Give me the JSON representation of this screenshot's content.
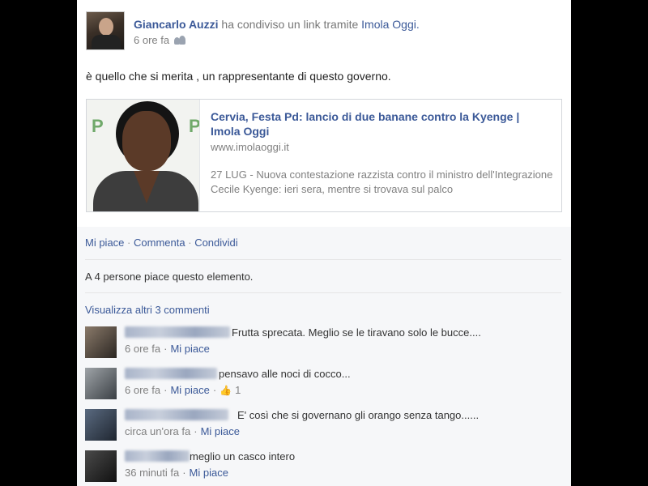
{
  "post": {
    "author": "Giancarlo Auzzi",
    "action_text": "ha condiviso un link tramite",
    "via": "Imola Oggi.",
    "time": "6 ore fa",
    "privacy_icon": "friends-icon",
    "status": "è quello che si merita , un rappresentante di questo governo."
  },
  "link": {
    "title": "Cervia, Festa Pd: lancio di due banane contro la Kyenge | Imola Oggi",
    "domain": "www.imolaoggi.it",
    "description": "27 LUG - Nuova contestazione razzista contro il ministro dell'Integrazione Cecile Kyenge: ieri sera, mentre si trovava sul palco",
    "thumb_logo": "P"
  },
  "actions": {
    "like": "Mi piace",
    "comment": "Commenta",
    "share": "Condividi",
    "sep": "·"
  },
  "likes_summary": "A 4 persone piace questo elemento.",
  "view_more": "Visualizza altri 3 commenti",
  "comments": [
    {
      "text": "Frutta sprecata. Meglio se le tiravano solo le bucce....",
      "time": "6 ore fa",
      "like": "Mi piace",
      "like_count": ""
    },
    {
      "text": "pensavo alle noci di cocco...",
      "time": "6 ore fa",
      "like": "Mi piace",
      "like_count": "1"
    },
    {
      "text": "E' così che si governano gli orango senza tango......",
      "time": "circa un'ora fa",
      "like": "Mi piace",
      "like_count": ""
    },
    {
      "text": "meglio un casco intero",
      "time": "36 minuti fa",
      "like": "Mi piace",
      "like_count": ""
    }
  ],
  "colors": {
    "link_blue": "#3b5998",
    "meta_gray": "#808080",
    "comment_area": "#f6f7f9"
  }
}
